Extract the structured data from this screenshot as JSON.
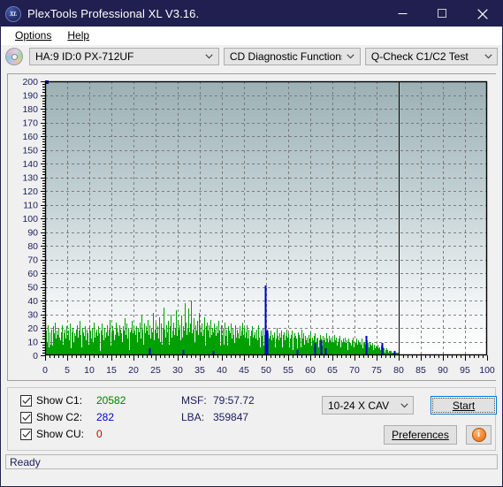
{
  "window": {
    "title": "PlexTools Professional XL V3.16.",
    "app_icon": "xl-logo-icon",
    "minimize": "minimize-icon",
    "maximize": "maximize-icon",
    "close": "close-icon"
  },
  "menubar": {
    "items": [
      {
        "label": "Options",
        "accel": "O"
      },
      {
        "label": "Help",
        "accel": "H"
      }
    ]
  },
  "toolbar": {
    "disc_icon": "cd-disc-icon",
    "drive_select": "HA:9 ID:0  PX-712UF",
    "function_select": "CD Diagnostic Functions",
    "test_select": "Q-Check C1/C2 Test"
  },
  "controls": {
    "show_c1": {
      "label": "Show C1:",
      "value": "20582",
      "color": "#008000",
      "checked": true
    },
    "show_c2": {
      "label": "Show C2:",
      "value": "282",
      "color": "#0000cc",
      "checked": true
    },
    "show_cu": {
      "label": "Show CU:",
      "value": "0",
      "color": "#cc0000",
      "checked": true
    },
    "msf_label": "MSF:",
    "msf_value": "79:57.72",
    "lba_label": "LBA:",
    "lba_value": "359847",
    "speed_select": "10-24 X CAV",
    "start_label": "Start",
    "start_accel": "S",
    "preferences_label": "Preferences",
    "preferences_accel": "P",
    "info_label": "i"
  },
  "statusbar": {
    "text": "Ready"
  },
  "chart_data": {
    "type": "area",
    "title": "",
    "xlabel": "",
    "ylabel": "",
    "xlim": [
      0,
      100
    ],
    "ylim": [
      0,
      200
    ],
    "x_ticks": [
      0,
      5,
      10,
      15,
      20,
      25,
      30,
      35,
      40,
      45,
      50,
      55,
      60,
      65,
      70,
      75,
      80,
      85,
      90,
      95,
      100
    ],
    "y_ticks": [
      0,
      10,
      20,
      30,
      40,
      50,
      60,
      70,
      80,
      90,
      100,
      110,
      120,
      130,
      140,
      150,
      160,
      170,
      180,
      190,
      200
    ],
    "grid": true,
    "legend_position": "none",
    "data_end_x": 80,
    "marker_point": {
      "x": 0.4,
      "y": 200,
      "color": "#0000cc"
    },
    "series": [
      {
        "name": "C1",
        "color": "#00a000",
        "note": "dense per-sample error bars, 0-80% of disc, typical 4-25, occasional spikes to 40",
        "values": [
          12,
          7,
          18,
          9,
          4,
          14,
          22,
          6,
          11,
          17,
          8,
          3,
          19,
          13,
          7,
          21,
          5,
          16,
          10,
          24,
          8,
          12,
          6,
          18,
          15,
          4,
          9,
          20,
          13,
          7,
          11,
          17,
          5,
          14,
          22,
          8,
          3,
          16,
          10,
          19,
          12,
          6,
          21,
          9,
          15,
          4,
          18,
          11,
          7,
          23,
          13,
          5,
          17,
          8,
          20,
          12,
          9,
          3,
          16,
          14,
          6,
          19,
          10,
          22,
          7,
          13,
          4,
          18,
          11,
          25,
          8,
          15,
          6,
          20,
          12,
          9,
          17,
          5,
          14,
          21,
          7,
          11,
          3,
          19,
          13,
          16,
          8,
          22,
          10,
          6,
          18,
          12,
          4,
          15,
          20,
          9,
          7,
          24,
          13,
          11,
          5,
          17,
          19,
          8,
          14,
          6,
          21,
          10,
          16,
          3,
          12,
          18,
          7,
          23,
          9,
          15,
          11,
          5,
          20,
          13,
          8,
          17,
          4,
          22,
          14,
          10,
          6,
          19,
          12,
          26,
          7,
          16,
          9,
          21,
          13,
          5,
          18,
          11,
          15,
          8,
          24,
          6,
          20,
          12,
          17,
          4,
          14,
          22,
          9,
          7,
          19,
          13,
          16,
          10,
          5,
          21,
          8,
          18,
          27,
          11,
          15,
          6,
          23,
          12,
          9,
          20,
          14,
          4,
          17,
          7,
          19,
          13,
          25,
          10,
          16,
          8,
          22,
          6,
          18,
          11,
          15,
          21,
          9,
          5,
          20,
          13,
          7,
          17,
          24,
          12,
          10,
          29,
          14,
          6,
          19,
          8,
          23,
          11,
          16,
          4,
          21,
          13,
          18,
          7,
          26,
          10,
          15,
          9,
          22,
          12,
          5,
          20,
          17,
          8,
          14,
          31,
          11,
          6,
          19,
          13,
          24,
          9,
          16,
          21,
          7,
          12,
          18,
          28,
          10,
          5,
          23,
          14,
          8,
          20,
          11,
          35,
          15,
          6,
          19,
          13,
          22,
          9,
          17,
          4,
          25,
          12,
          8,
          21,
          16,
          10,
          30,
          13,
          7,
          18,
          11,
          24,
          15,
          5,
          20,
          9,
          33,
          14,
          12,
          26,
          8,
          17,
          19,
          6,
          22,
          11,
          16,
          29,
          10,
          13,
          7,
          21,
          18,
          38,
          12,
          9,
          24,
          15,
          6,
          20,
          34,
          11,
          17,
          8,
          23,
          13,
          40,
          10,
          16,
          5,
          19,
          27,
          12,
          9,
          22,
          14,
          7,
          18,
          11,
          25,
          15,
          31,
          8,
          20,
          13,
          6,
          17,
          23,
          10,
          14,
          19,
          9,
          28,
          12,
          7,
          21,
          16,
          11,
          24,
          8,
          18,
          5,
          22,
          13,
          9,
          26,
          15,
          10,
          20,
          7,
          17,
          12,
          23,
          6,
          19,
          14,
          8,
          21,
          11,
          16,
          25,
          9,
          13,
          18,
          7,
          22,
          10,
          15,
          6,
          20,
          12,
          8,
          17,
          24,
          11,
          14,
          9,
          19,
          7,
          21,
          13,
          5,
          18,
          10,
          16,
          23,
          8,
          12,
          20,
          6,
          15,
          11,
          9,
          17,
          22,
          7,
          13,
          19,
          10,
          5,
          16,
          12,
          8,
          21,
          14,
          6,
          18,
          11,
          24,
          9,
          15,
          7,
          20,
          13,
          10,
          17,
          5,
          22,
          12,
          8,
          16,
          19,
          7,
          11,
          14,
          9,
          18,
          6,
          21,
          13,
          10,
          15,
          8,
          17,
          12,
          5,
          19,
          11,
          7,
          16,
          22,
          9,
          13,
          6,
          18,
          10,
          14,
          8,
          20,
          12,
          7,
          15,
          11,
          17,
          5,
          13,
          9,
          19,
          8,
          16,
          6,
          12,
          14,
          10,
          7,
          18,
          11,
          5,
          15,
          9,
          13,
          8,
          17,
          6,
          12,
          10,
          20,
          7,
          14,
          9,
          11,
          16,
          5,
          13,
          8,
          18,
          10,
          6,
          15,
          12,
          9,
          17,
          7,
          11,
          14,
          5,
          19,
          8,
          13,
          10,
          16,
          6,
          12,
          9,
          15,
          7,
          11,
          18,
          4,
          13,
          8,
          16,
          10,
          6,
          14,
          9,
          12,
          5,
          17,
          7,
          11,
          15,
          8,
          13,
          6,
          10,
          19,
          9,
          12,
          5,
          16,
          8,
          14,
          7,
          11,
          10,
          13,
          6,
          9,
          15,
          8,
          12,
          5,
          17,
          10,
          7,
          13,
          9,
          11,
          6,
          14,
          8,
          16,
          5,
          10,
          12,
          7,
          9,
          13,
          6,
          11,
          8,
          15,
          4,
          10,
          12,
          7,
          14,
          9,
          6,
          11,
          13,
          5,
          8,
          10,
          16,
          7,
          12,
          9,
          4,
          14,
          6,
          11,
          8,
          13,
          5,
          10,
          7,
          12,
          9,
          15,
          6,
          8,
          11,
          4,
          13,
          7,
          10,
          9,
          12,
          5,
          8,
          14,
          6,
          11,
          7,
          9,
          4,
          12,
          8,
          10,
          6,
          13,
          5,
          9,
          7,
          11,
          4,
          8,
          12,
          6,
          10,
          3,
          9,
          7,
          11,
          5,
          8,
          13,
          6,
          4,
          10,
          7,
          9,
          12,
          5,
          8,
          6,
          11,
          4,
          9,
          7,
          10,
          3,
          8,
          6,
          12,
          5,
          9,
          4,
          7,
          10,
          6,
          8,
          3,
          11,
          5,
          7,
          9,
          4,
          6,
          10,
          3,
          8,
          5,
          7,
          2,
          9,
          4,
          6,
          8,
          3,
          5,
          7,
          2,
          6,
          4,
          8,
          3,
          5,
          6,
          2,
          4,
          7,
          3,
          5,
          2,
          4,
          6,
          3,
          5,
          2,
          4,
          3,
          5,
          2,
          3,
          4,
          2,
          3,
          2,
          3,
          2,
          2,
          3,
          2,
          2,
          1,
          2,
          2,
          1,
          2,
          1,
          1,
          2,
          1,
          1,
          1,
          1,
          0
        ]
      },
      {
        "name": "C2",
        "color": "#0000cc",
        "note": "sparse blue spikes; tallest ~51 near x=50",
        "points": [
          {
            "x": 23.5,
            "y": 5
          },
          {
            "x": 31.2,
            "y": 4
          },
          {
            "x": 38.0,
            "y": 3
          },
          {
            "x": 49.8,
            "y": 51
          },
          {
            "x": 50.1,
            "y": 18
          },
          {
            "x": 57.0,
            "y": 4
          },
          {
            "x": 61.0,
            "y": 9
          },
          {
            "x": 62.3,
            "y": 11
          },
          {
            "x": 63.4,
            "y": 5
          },
          {
            "x": 72.6,
            "y": 14
          },
          {
            "x": 76.2,
            "y": 9
          },
          {
            "x": 79.1,
            "y": 3
          }
        ]
      }
    ]
  }
}
